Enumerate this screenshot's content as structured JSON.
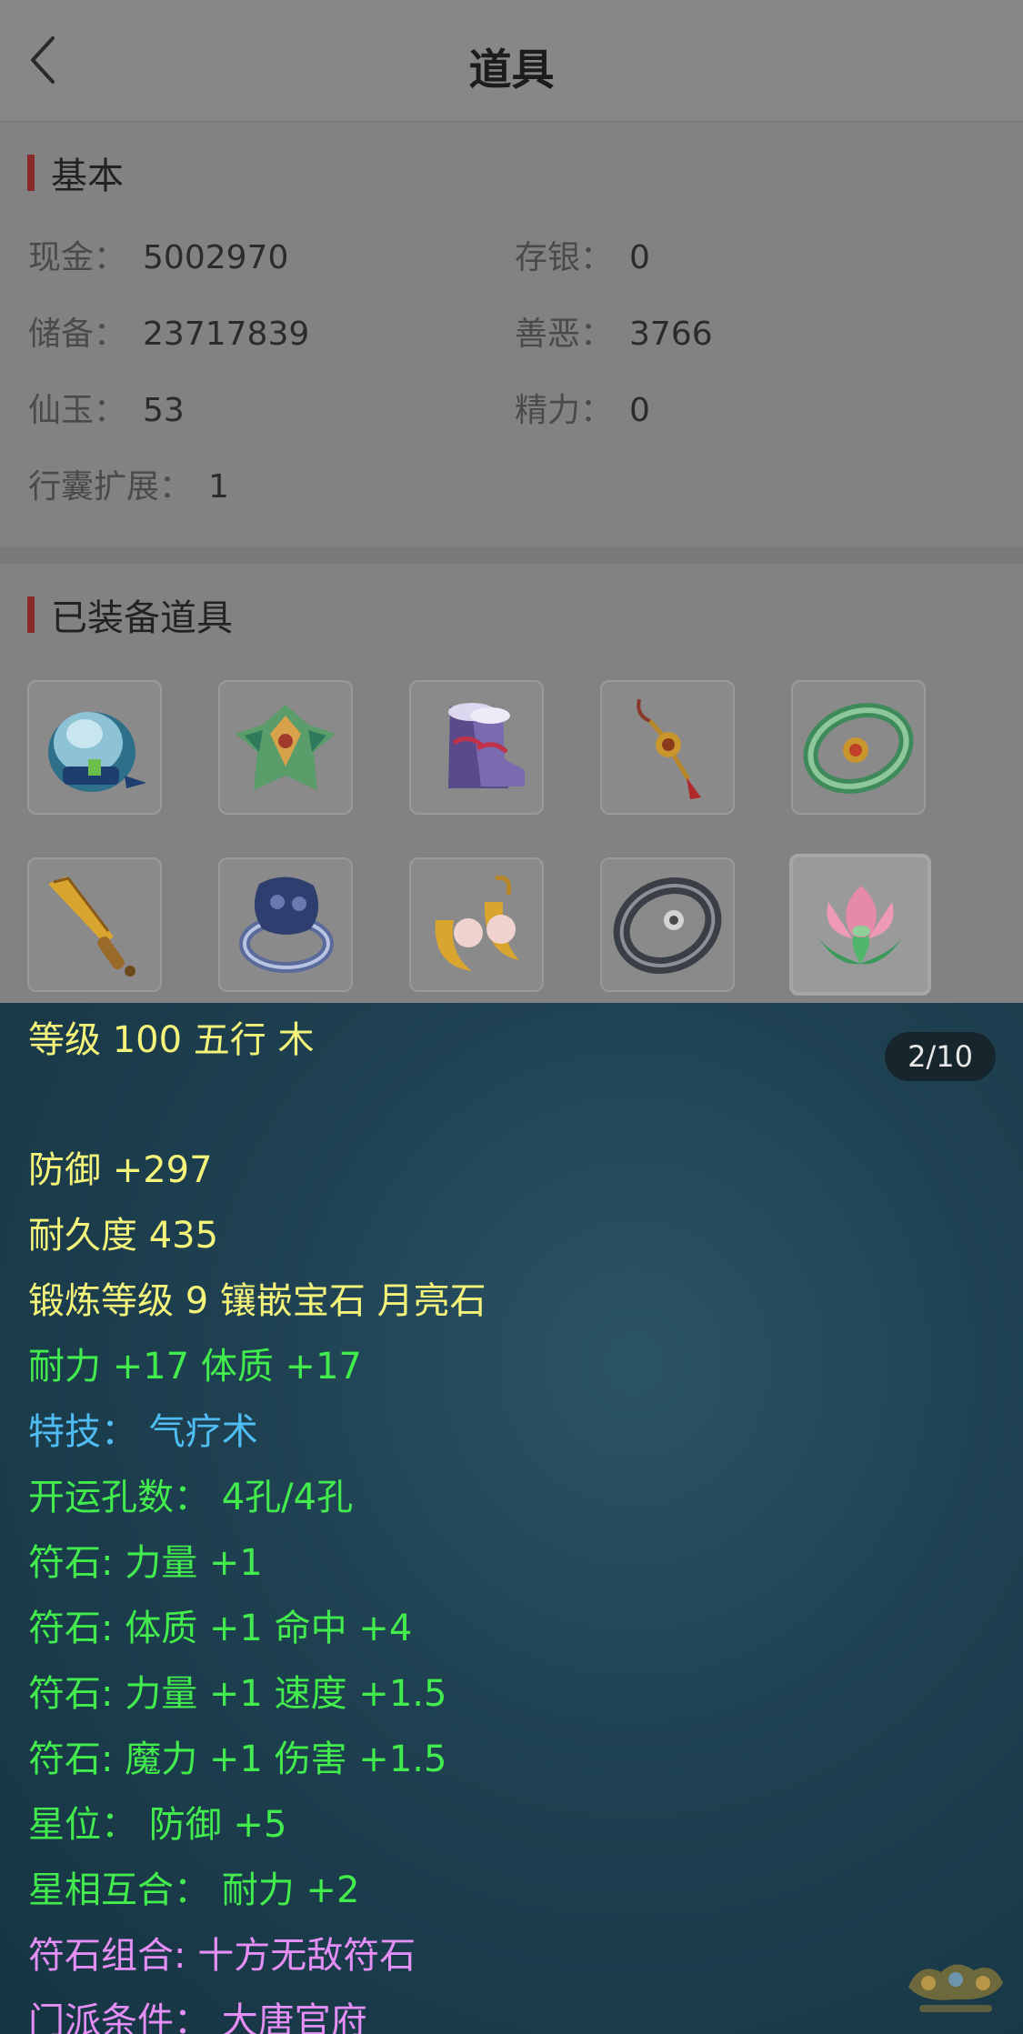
{
  "header": {
    "title": "道具"
  },
  "basic": {
    "title": "基本",
    "fields": [
      {
        "label": "现金",
        "value": "5002970"
      },
      {
        "label": "存银",
        "value": "0"
      },
      {
        "label": "储备",
        "value": "23717839"
      },
      {
        "label": "善恶",
        "value": "3766"
      },
      {
        "label": "仙玉",
        "value": "53"
      },
      {
        "label": "精力",
        "value": "0"
      },
      {
        "label": "行囊扩展",
        "value": "1"
      }
    ],
    "colon": "："
  },
  "equipped": {
    "title": "已装备道具",
    "items": [
      {
        "icon": "helmet-icon"
      },
      {
        "icon": "armor-icon"
      },
      {
        "icon": "boots-icon"
      },
      {
        "icon": "pendant-icon"
      },
      {
        "icon": "belt-icon"
      },
      {
        "icon": "blade-icon"
      },
      {
        "icon": "ring-icon"
      },
      {
        "icon": "earrings-icon"
      },
      {
        "icon": "bracelet-icon"
      },
      {
        "icon": "lotus-icon"
      }
    ]
  },
  "detail": {
    "counter": "2/10",
    "lines": [
      {
        "text": "等级 100 五行 木",
        "color": "yellow"
      },
      {
        "text": "防御 +297",
        "color": "yellow"
      },
      {
        "text": "耐久度 435",
        "color": "yellow"
      },
      {
        "text": "锻炼等级 9 镶嵌宝石 月亮石",
        "color": "yellow"
      },
      {
        "text": "耐力 +17 体质 +17",
        "color": "green"
      },
      {
        "text": "特技：  气疗术",
        "color": "blue"
      },
      {
        "text": "开运孔数：  4孔/4孔",
        "color": "green"
      },
      {
        "text": "符石: 力量 +1",
        "color": "green"
      },
      {
        "text": "符石: 体质 +1 命中 +4",
        "color": "green"
      },
      {
        "text": "符石: 力量 +1 速度 +1.5",
        "color": "green"
      },
      {
        "text": "符石: 魔力 +1 伤害 +1.5",
        "color": "green"
      },
      {
        "text": "星位：  防御 +5",
        "color": "green"
      },
      {
        "text": "星相互合：  耐力 +2",
        "color": "green"
      },
      {
        "text": "符石组合: 十方无敌符石",
        "color": "pink"
      },
      {
        "text": "门派条件：  大唐官府",
        "color": "pink"
      }
    ]
  },
  "colors": {
    "yellow": "#f4f37a",
    "green": "#43ec4d",
    "blue": "#4fbdf3",
    "pink": "#e58ef5"
  }
}
